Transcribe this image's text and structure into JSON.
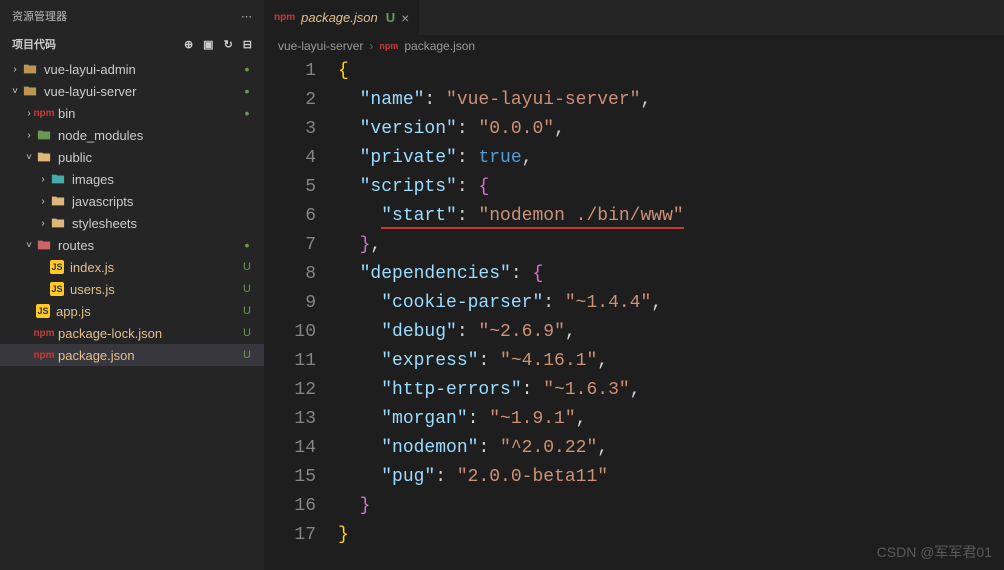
{
  "explorer": {
    "title": "资源管理器",
    "ellipsis": "⋯",
    "projectLabel": "项目代码",
    "tree": [
      {
        "depth": 0,
        "twist": ">",
        "icon": "folder",
        "iconClass": "ico-folder",
        "label": "vue-layui-admin",
        "badge": "dot",
        "interact": true
      },
      {
        "depth": 0,
        "twist": "v",
        "icon": "folder",
        "iconClass": "ico-folder-open",
        "label": "vue-layui-server",
        "badge": "dot",
        "interact": true
      },
      {
        "depth": 1,
        "twist": ">",
        "icon": "npm",
        "iconClass": "ico-npm",
        "label": "bin",
        "badge": "dot",
        "interact": true
      },
      {
        "depth": 1,
        "twist": ">",
        "icon": "folder",
        "iconClass": "ico-folder-green",
        "label": "node_modules",
        "badge": "",
        "interact": true
      },
      {
        "depth": 1,
        "twist": "v",
        "icon": "folder",
        "iconClass": "ico-folder-yellow",
        "label": "public",
        "badge": "",
        "interact": true
      },
      {
        "depth": 2,
        "twist": ">",
        "icon": "folder",
        "iconClass": "ico-folder-teal",
        "label": "images",
        "badge": "",
        "interact": true
      },
      {
        "depth": 2,
        "twist": ">",
        "icon": "folder",
        "iconClass": "ico-folder-yellow",
        "label": "javascripts",
        "badge": "",
        "interact": true
      },
      {
        "depth": 2,
        "twist": ">",
        "icon": "folder",
        "iconClass": "ico-folder-yellow",
        "label": "stylesheets",
        "badge": "",
        "interact": true
      },
      {
        "depth": 1,
        "twist": "v",
        "icon": "folder",
        "iconClass": "ico-folder-red",
        "label": "routes",
        "badge": "dot",
        "interact": true
      },
      {
        "depth": 2,
        "twist": "",
        "icon": "js",
        "iconClass": "ico-js",
        "label": "index.js",
        "badge": "U",
        "interact": true
      },
      {
        "depth": 2,
        "twist": "",
        "icon": "js",
        "iconClass": "ico-js",
        "label": "users.js",
        "badge": "U",
        "interact": true
      },
      {
        "depth": 1,
        "twist": "",
        "icon": "js",
        "iconClass": "ico-js",
        "label": "app.js",
        "badge": "U",
        "interact": true
      },
      {
        "depth": 1,
        "twist": "",
        "icon": "npm",
        "iconClass": "ico-npm",
        "label": "package-lock.json",
        "badge": "U",
        "interact": true
      },
      {
        "depth": 1,
        "twist": "",
        "icon": "npm",
        "iconClass": "ico-npm",
        "label": "package.json",
        "badge": "U",
        "interact": true,
        "selected": true
      }
    ]
  },
  "tab": {
    "file": "package.json",
    "uMark": "U",
    "close": "×"
  },
  "crumbs": {
    "root": "vue-layui-server",
    "file": "package.json"
  },
  "code": {
    "lines": [
      [
        {
          "c": "tok-b",
          "t": "{"
        }
      ],
      [
        {
          "c": "",
          "t": "  "
        },
        {
          "c": "tok-k",
          "t": "\"name\""
        },
        {
          "c": "tok-p",
          "t": ": "
        },
        {
          "c": "tok-s",
          "t": "\"vue-layui-server\""
        },
        {
          "c": "tok-p",
          "t": ","
        }
      ],
      [
        {
          "c": "",
          "t": "  "
        },
        {
          "c": "tok-k",
          "t": "\"version\""
        },
        {
          "c": "tok-p",
          "t": ": "
        },
        {
          "c": "tok-s",
          "t": "\"0.0.0\""
        },
        {
          "c": "tok-p",
          "t": ","
        }
      ],
      [
        {
          "c": "",
          "t": "  "
        },
        {
          "c": "tok-k",
          "t": "\"private\""
        },
        {
          "c": "tok-p",
          "t": ": "
        },
        {
          "c": "tok-bool",
          "t": "true"
        },
        {
          "c": "tok-p",
          "t": ","
        }
      ],
      [
        {
          "c": "",
          "t": "  "
        },
        {
          "c": "tok-k",
          "t": "\"scripts\""
        },
        {
          "c": "tok-p",
          "t": ": "
        },
        {
          "c": "tok-pink",
          "t": "{"
        }
      ],
      [
        {
          "c": "",
          "t": "    "
        },
        {
          "c": "tok-k underline-red",
          "t": "\"start\""
        },
        {
          "c": "tok-p underline-red",
          "t": ": "
        },
        {
          "c": "tok-s underline-red",
          "t": "\"nodemon ./bin/www\""
        }
      ],
      [
        {
          "c": "",
          "t": "  "
        },
        {
          "c": "tok-pink",
          "t": "}"
        },
        {
          "c": "tok-p",
          "t": ","
        }
      ],
      [
        {
          "c": "",
          "t": "  "
        },
        {
          "c": "tok-k",
          "t": "\"dependencies\""
        },
        {
          "c": "tok-p",
          "t": ": "
        },
        {
          "c": "tok-pink",
          "t": "{"
        }
      ],
      [
        {
          "c": "",
          "t": "    "
        },
        {
          "c": "tok-k",
          "t": "\"cookie-parser\""
        },
        {
          "c": "tok-p",
          "t": ": "
        },
        {
          "c": "tok-s",
          "t": "\"~1.4.4\""
        },
        {
          "c": "tok-p",
          "t": ","
        }
      ],
      [
        {
          "c": "",
          "t": "    "
        },
        {
          "c": "tok-k",
          "t": "\"debug\""
        },
        {
          "c": "tok-p",
          "t": ": "
        },
        {
          "c": "tok-s",
          "t": "\"~2.6.9\""
        },
        {
          "c": "tok-p",
          "t": ","
        }
      ],
      [
        {
          "c": "",
          "t": "    "
        },
        {
          "c": "tok-k",
          "t": "\"express\""
        },
        {
          "c": "tok-p",
          "t": ": "
        },
        {
          "c": "tok-s",
          "t": "\"~4.16.1\""
        },
        {
          "c": "tok-p",
          "t": ","
        }
      ],
      [
        {
          "c": "",
          "t": "    "
        },
        {
          "c": "tok-k",
          "t": "\"http-errors\""
        },
        {
          "c": "tok-p",
          "t": ": "
        },
        {
          "c": "tok-s",
          "t": "\"~1.6.3\""
        },
        {
          "c": "tok-p",
          "t": ","
        }
      ],
      [
        {
          "c": "",
          "t": "    "
        },
        {
          "c": "tok-k",
          "t": "\"morgan\""
        },
        {
          "c": "tok-p",
          "t": ": "
        },
        {
          "c": "tok-s",
          "t": "\"~1.9.1\""
        },
        {
          "c": "tok-p",
          "t": ","
        }
      ],
      [
        {
          "c": "",
          "t": "    "
        },
        {
          "c": "tok-k",
          "t": "\"nodemon\""
        },
        {
          "c": "tok-p",
          "t": ": "
        },
        {
          "c": "tok-s",
          "t": "\"^2.0.22\""
        },
        {
          "c": "tok-p",
          "t": ","
        }
      ],
      [
        {
          "c": "",
          "t": "    "
        },
        {
          "c": "tok-k",
          "t": "\"pug\""
        },
        {
          "c": "tok-p",
          "t": ": "
        },
        {
          "c": "tok-s",
          "t": "\"2.0.0-beta11\""
        }
      ],
      [
        {
          "c": "",
          "t": "  "
        },
        {
          "c": "tok-pink",
          "t": "}"
        }
      ],
      [
        {
          "c": "tok-b",
          "t": "}"
        }
      ]
    ]
  },
  "watermark": "CSDN @军军君01"
}
